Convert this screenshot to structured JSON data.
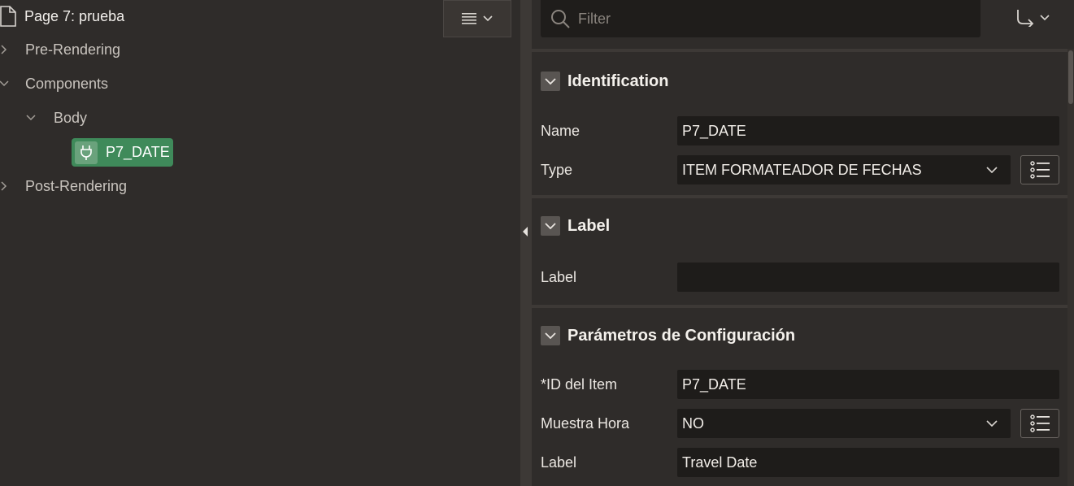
{
  "tree": {
    "page_title": "Page 7: prueba",
    "nodes": {
      "pre_rendering": "Pre-Rendering",
      "components": "Components",
      "body": "Body",
      "selected_item": "P7_DATE",
      "post_rendering": "Post-Rendering"
    }
  },
  "toolbar": {
    "filter_placeholder": "Filter",
    "icons": {
      "menu": "menu-lines-icon",
      "goto": "goto-arrow-icon"
    }
  },
  "sections": {
    "identification": {
      "title": "Identification",
      "name_label": "Name",
      "name_value": "P7_DATE",
      "type_label": "Type",
      "type_value": "ITEM FORMATEADOR DE FECHAS"
    },
    "label": {
      "title": "Label",
      "label_label": "Label",
      "label_value": ""
    },
    "config": {
      "title": "Parámetros de Configuración",
      "item_id_label": "*ID del Item",
      "item_id_value": "P7_DATE",
      "show_time_label": "Muestra Hora",
      "show_time_value": "NO",
      "label_label": "Label",
      "label_value": "Travel Date"
    }
  },
  "colors": {
    "background": "#2f2c2a",
    "selected_node": "#3f8a5a",
    "field_bg": "#1e1c1a"
  }
}
